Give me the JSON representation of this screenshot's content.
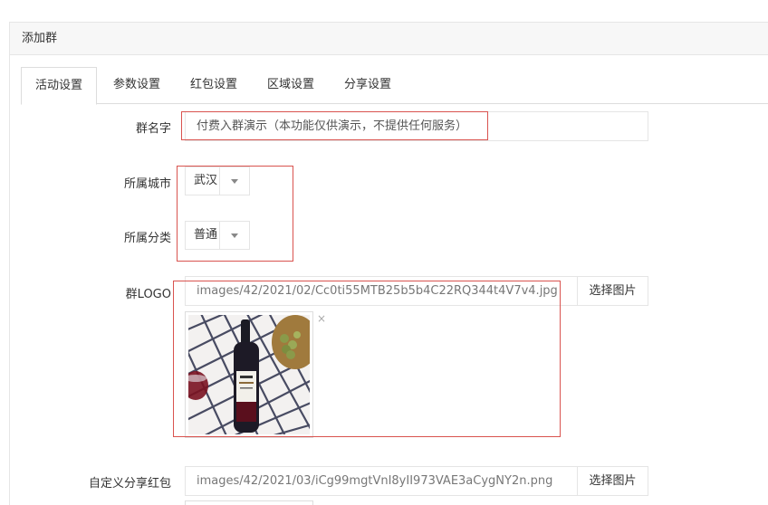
{
  "panel": {
    "title": "添加群"
  },
  "tabs": [
    {
      "label": "活动设置",
      "active": true
    },
    {
      "label": "参数设置",
      "active": false
    },
    {
      "label": "红包设置",
      "active": false
    },
    {
      "label": "区域设置",
      "active": false
    },
    {
      "label": "分享设置",
      "active": false
    }
  ],
  "form": {
    "group_name": {
      "label": "群名字",
      "value": "付费入群演示（本功能仅供演示，不提供任何服务）"
    },
    "city": {
      "label": "所属城市",
      "value": "武汉"
    },
    "category": {
      "label": "所属分类",
      "value": "普通"
    },
    "logo": {
      "label": "群LOGO",
      "value": "images/42/2021/02/Cc0ti55MTB25b5b4C22RQ344t4V7v4.jpg",
      "button": "选择图片",
      "remove": "×"
    },
    "share_packet": {
      "label": "自定义分享红包",
      "value": "images/42/2021/03/iCg99mgtVnI8yII973VAE3aCygNY2n.png",
      "button": "选择图片"
    }
  },
  "colors": {
    "highlight_border": "#d9534f",
    "wine": "#5a0f1d",
    "tablecloth_line": "#2b2f4a",
    "grapes": "#8a9a4a"
  },
  "icons": {
    "select_caret": "caret-down-icon",
    "remove": "close-icon"
  }
}
